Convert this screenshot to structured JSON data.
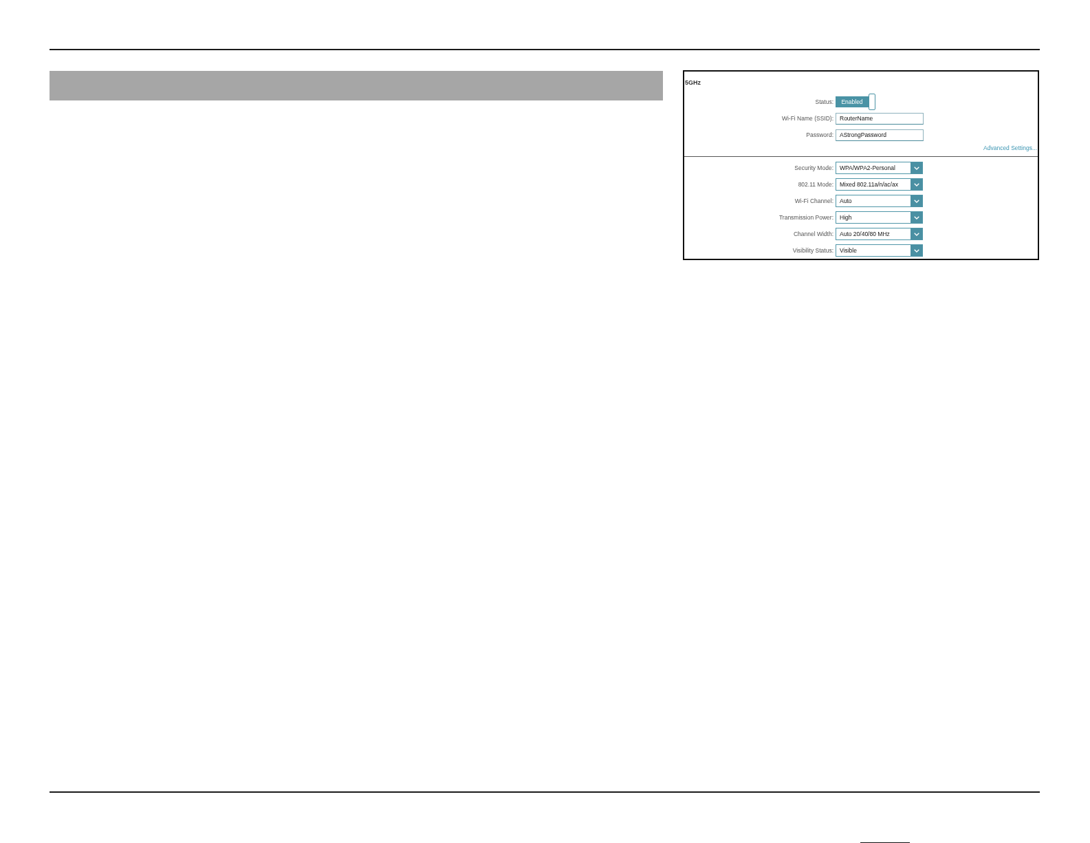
{
  "panel": {
    "title": "5GHz",
    "status": {
      "label": "Status:",
      "value": "Enabled",
      "on": true
    },
    "fields": [
      {
        "label": "Wi-Fi Name (SSID):",
        "value": "RouterName"
      },
      {
        "label": "Password:",
        "value": "AStrongPassword"
      }
    ],
    "link": "Advanced Settings...",
    "selects": [
      {
        "label": "Security Mode:",
        "value": "WPA/WPA2-Personal"
      },
      {
        "label": "802.11 Mode:",
        "value": "Mixed 802.11a/n/ac/ax"
      },
      {
        "label": "Wi-Fi Channel:",
        "value": "Auto"
      },
      {
        "label": "Transmission Power:",
        "value": "High"
      },
      {
        "label": "Channel Width:",
        "value": "Auto 20/40/80 MHz"
      },
      {
        "label": "Visibility Status:",
        "value": "Visible"
      }
    ]
  }
}
